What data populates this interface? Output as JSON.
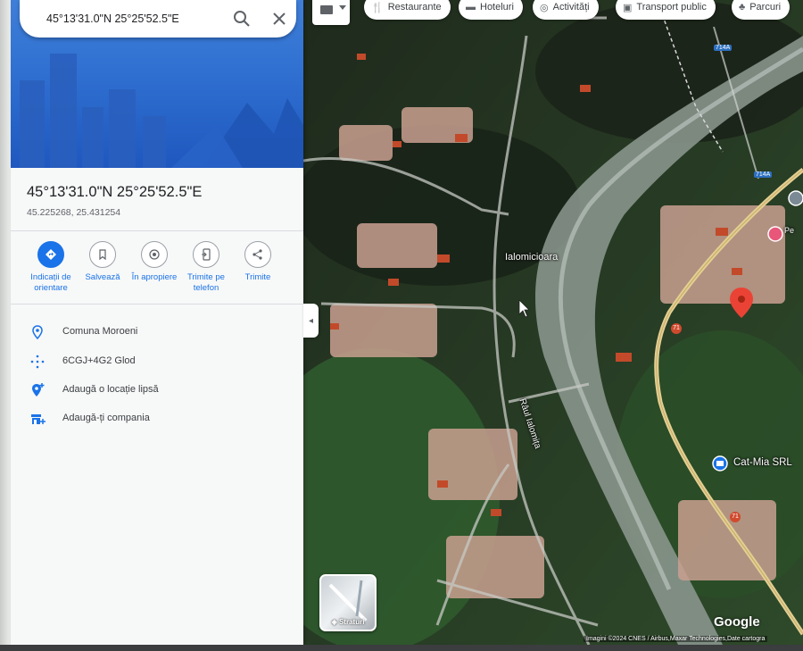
{
  "search": {
    "value": "45°13'31.0\"N 25°25'52.5\"E"
  },
  "place": {
    "title": "45°13'31.0\"N 25°25'52.5\"E",
    "decimal": "45.225268, 25.431254"
  },
  "actions": [
    {
      "label": "Indicații de orientare",
      "icon": "directions-icon"
    },
    {
      "label": "Salvează",
      "icon": "bookmark-icon"
    },
    {
      "label": "În apropiere",
      "icon": "nearby-icon"
    },
    {
      "label": "Trimite pe telefon",
      "icon": "send-to-phone-icon"
    },
    {
      "label": "Trimite",
      "icon": "share-icon"
    }
  ],
  "info": [
    {
      "text": "Comuna Moroeni",
      "icon": "location-pin-icon"
    },
    {
      "text": "6CGJ+4G2 Glod",
      "icon": "plus-code-icon"
    },
    {
      "text": "Adaugă o locație lipsă",
      "icon": "add-location-icon"
    },
    {
      "text": "Adaugă-ți compania",
      "icon": "add-business-icon"
    }
  ],
  "map": {
    "chips": [
      {
        "label": "Restaurante",
        "icon": "restaurant-icon"
      },
      {
        "label": "Hoteluri",
        "icon": "hotel-icon"
      },
      {
        "label": "Activități",
        "icon": "camera-icon"
      },
      {
        "label": "Transport public",
        "icon": "transit-icon"
      },
      {
        "label": "Parcuri",
        "icon": "park-icon"
      }
    ],
    "labels": {
      "locality": "Ialomicioara",
      "river": "Râul Ialomița",
      "business": "Cat-Mia SRL",
      "road_714a_1": "714A",
      "road_714a_2": "714A",
      "road_71_1": "71",
      "road_71_2": "71",
      "pe": "Pe"
    },
    "layers_label": "Straturi",
    "logo": "Google",
    "attribution": "Imagini ©2024 CNES / Airbus,Maxar Technologies,Date cartogra"
  },
  "colors": {
    "accent": "#1a73e8",
    "pin": "#ea4335",
    "hero_blue": "#2f6fd0"
  }
}
